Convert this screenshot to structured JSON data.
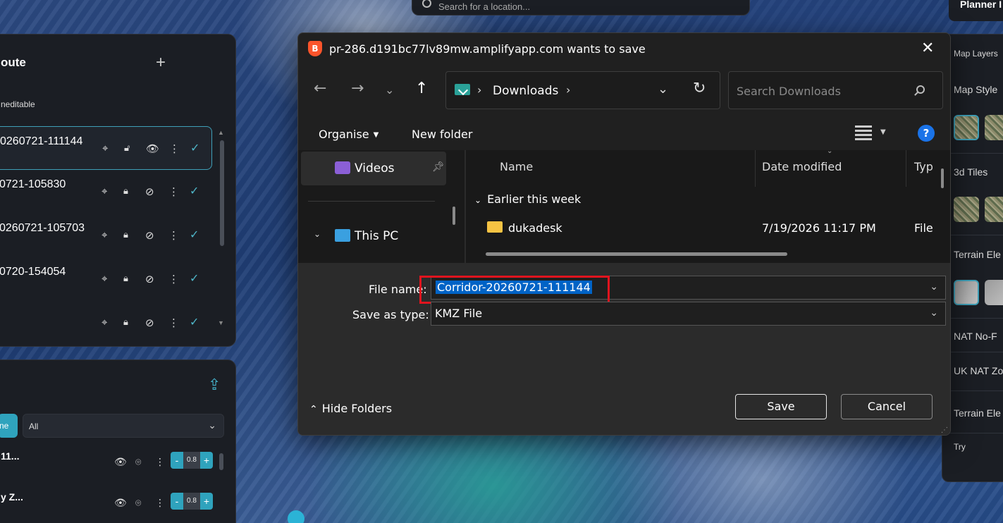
{
  "map": {
    "search_placeholder": "Search for a location..."
  },
  "route_panel": {
    "title": "oute",
    "add_label": "+",
    "subtitle": "neditable",
    "routes": [
      {
        "name": "0260721-111144"
      },
      {
        "name": "0721-105830"
      },
      {
        "name": "0260721-105703"
      },
      {
        "name": "0720-154054"
      },
      {
        "name": ""
      }
    ]
  },
  "layers_panel": {
    "chip_label": "ne",
    "filter_value": "All",
    "layers": [
      {
        "name": "11...",
        "opacity": "0.8"
      },
      {
        "name": "y Z...",
        "opacity": "0.8"
      }
    ]
  },
  "right_panel": {
    "planner_tab": "Planner I",
    "items": [
      "Map Layers",
      "Map Style",
      "3d Tiles",
      "Terrain Ele",
      "NAT No-F",
      "UK NAT Zo",
      "Terrain Ele",
      "Try"
    ]
  },
  "dialog": {
    "title": "pr-286.d191bc77lv89mw.amplifyapp.com wants to save",
    "app_icon_letter": "B",
    "address_location": "Downloads",
    "search_placeholder": "Search Downloads",
    "toolbar": {
      "organise": "Organise",
      "new_folder": "New folder",
      "help": "?"
    },
    "nav_items": [
      {
        "label": "Videos"
      },
      {
        "label": "This PC"
      }
    ],
    "columns": {
      "name": "Name",
      "date_modified": "Date modified",
      "type": "Typ"
    },
    "group_header": "Earlier this week",
    "files": [
      {
        "name": "dukadesk",
        "date": "7/19/2026 11:17 PM",
        "type": "File"
      }
    ],
    "form": {
      "file_name_label": "File name:",
      "file_name_value": "Corridor-20260721-111144",
      "save_type_label": "Save as type:",
      "save_type_value": "KMZ File"
    },
    "hide_folders": "Hide Folders",
    "save_button": "Save",
    "cancel_button": "Cancel"
  },
  "colors": {
    "accent": "#2fa3bd",
    "dialog_bg": "#202020",
    "selection": "#0063c6",
    "annotation": "#e0141e"
  }
}
